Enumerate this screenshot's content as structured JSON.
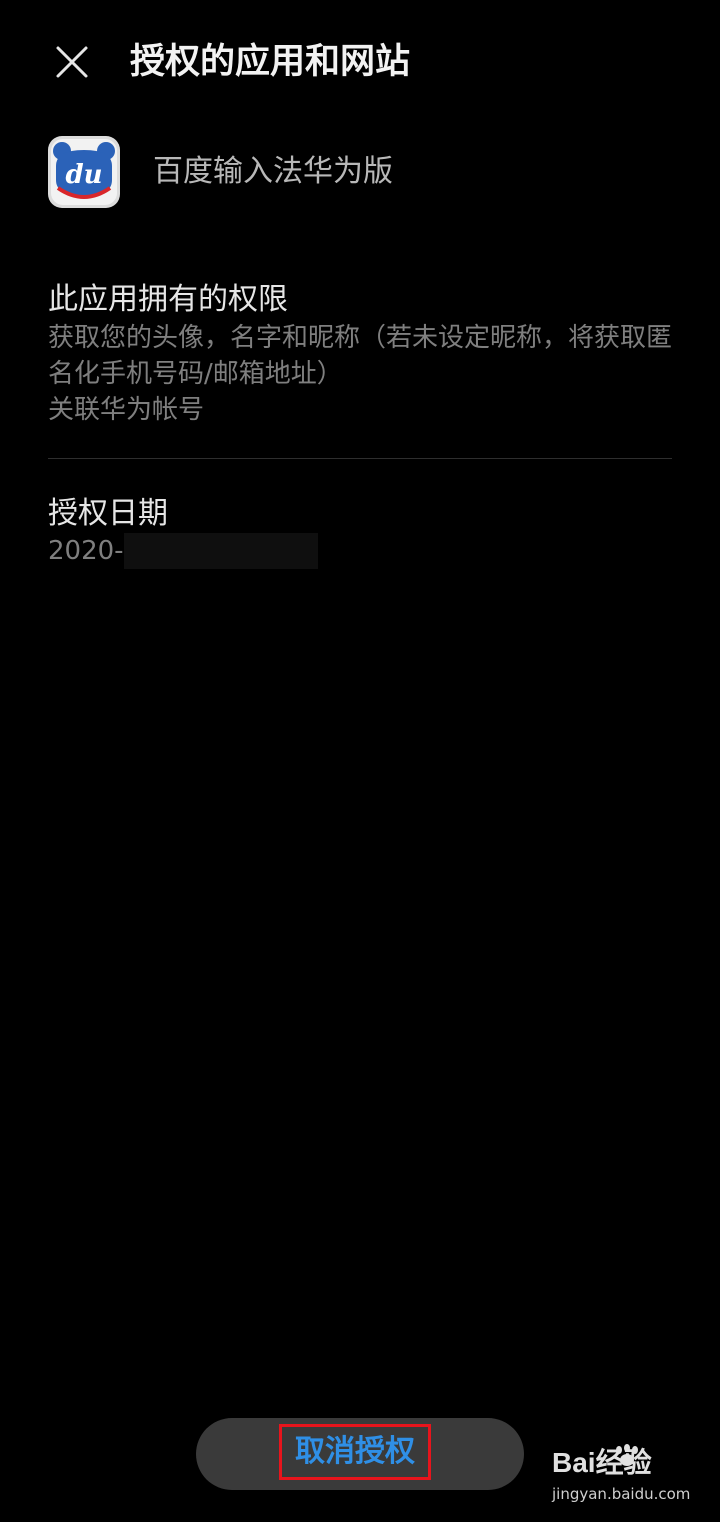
{
  "header": {
    "close_icon": "close-icon",
    "title": "授权的应用和网站"
  },
  "app": {
    "icon": "baidu-input-app-icon",
    "icon_text": "du",
    "name": "百度输入法华为版"
  },
  "permissions": {
    "title": "此应用拥有的权限",
    "items": [
      "获取您的头像，名字和昵称（若未设定昵称，将获取匿名化手机号码/邮箱地址）",
      "关联华为帐号"
    ]
  },
  "authorization_date": {
    "title": "授权日期",
    "value": "2020-"
  },
  "revoke": {
    "label": "取消授权"
  },
  "watermark": {
    "logo_text": "Bai经验",
    "url": "jingyan.baidu.com"
  },
  "colors": {
    "background": "#000000",
    "accent": "#2f8fe6",
    "highlight_box": "#e8141c",
    "button_bg": "#3a3a3a",
    "secondary_text": "#7f7f7f"
  }
}
